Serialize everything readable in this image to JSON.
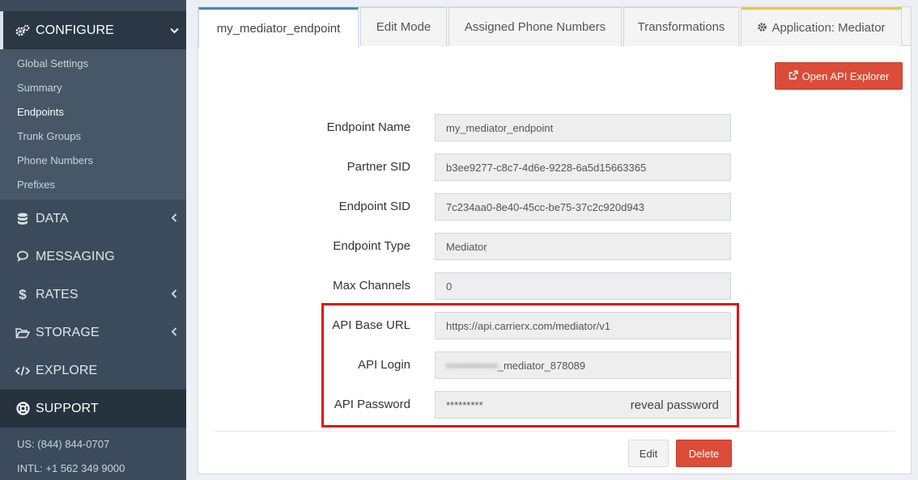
{
  "sidebar": {
    "configure": {
      "label": "CONFIGURE",
      "icon": "gears-icon"
    },
    "configure_items": [
      "Global Settings",
      "Summary",
      "Endpoints",
      "Trunk Groups",
      "Phone Numbers",
      "Prefixes"
    ],
    "active_item": "Endpoints",
    "data": {
      "label": "DATA",
      "icon": "database-icon"
    },
    "messaging": {
      "label": "MESSAGING",
      "icon": "comments-icon"
    },
    "rates": {
      "label": "RATES",
      "icon": "dollar-icon"
    },
    "storage": {
      "label": "STORAGE",
      "icon": "folder-open-icon"
    },
    "explore": {
      "label": "EXPLORE",
      "icon": "code-icon"
    },
    "support": {
      "label": "SUPPORT",
      "icon": "life-ring-icon"
    },
    "support_lines": [
      "US: (844) 844-0707",
      "INTL: +1 562 349 9000"
    ]
  },
  "tabs": [
    {
      "label": "my_mediator_endpoint",
      "active": true
    },
    {
      "label": "Edit Mode"
    },
    {
      "label": "Assigned Phone Numbers"
    },
    {
      "label": "Transformations"
    },
    {
      "label": "Application: Mediator",
      "icon": "gear-icon"
    }
  ],
  "buttons": {
    "open_api_explorer": "Open API Explorer",
    "edit": "Edit",
    "delete": "Delete"
  },
  "fields": {
    "endpoint_name": {
      "label": "Endpoint Name",
      "value": "my_mediator_endpoint"
    },
    "partner_sid": {
      "label": "Partner SID",
      "value": "b3ee9277-c8c7-4d6e-9228-6a5d15663365"
    },
    "endpoint_sid": {
      "label": "Endpoint SID",
      "value": "7c234aa0-8e40-45cc-be75-37c2c920d943"
    },
    "endpoint_type": {
      "label": "Endpoint Type",
      "value": "Mediator"
    },
    "max_channels": {
      "label": "Max Channels",
      "value": "0"
    },
    "api_base_url": {
      "label": "API Base URL",
      "value": "https://api.carrierx.com/mediator/v1"
    },
    "api_login": {
      "label": "API Login",
      "value_blurred": "••••••••••••••",
      "value_suffix": "_mediator_878089"
    },
    "api_password": {
      "label": "API Password",
      "value": "*********",
      "reveal": "reveal password"
    }
  },
  "colors": {
    "sidebar_bg": "#3c4b5b",
    "accent_red": "#dd4b39",
    "highlight_red": "#e01019",
    "tab_active_top": "#3c8dbc",
    "tab_app_top": "#f3c532"
  }
}
